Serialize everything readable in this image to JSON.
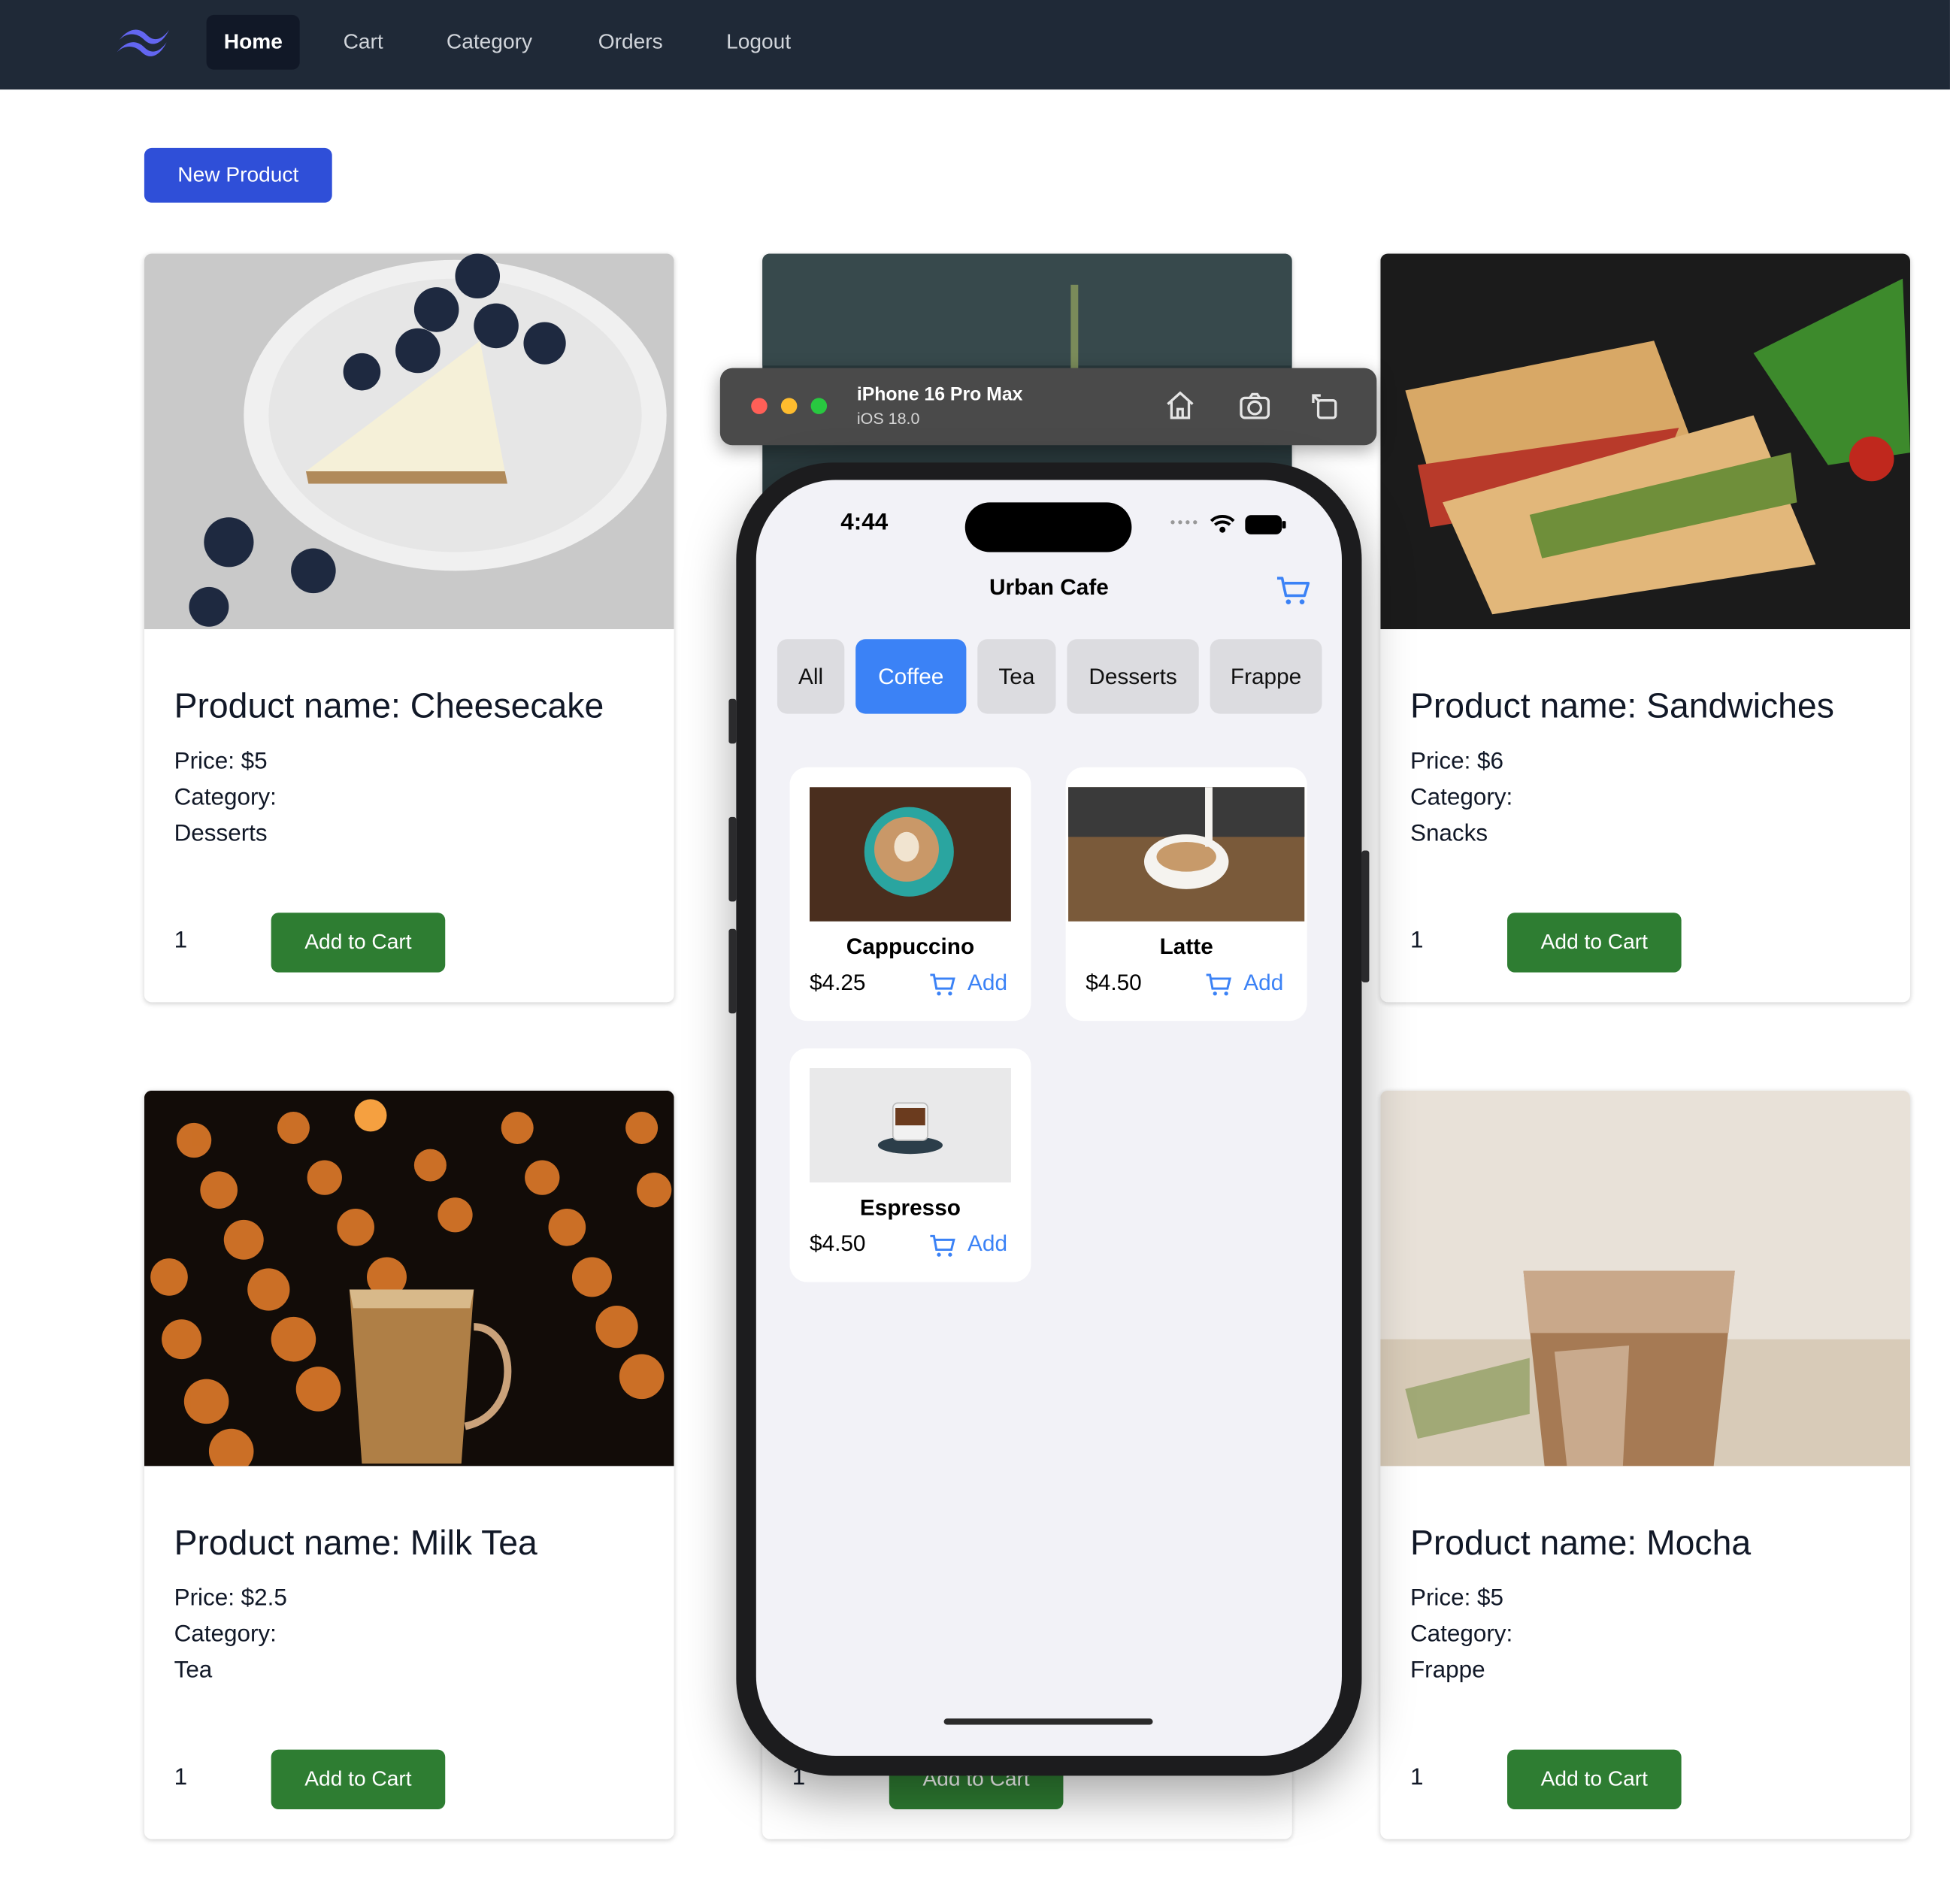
{
  "nav": {
    "items": [
      {
        "label": "Home",
        "active": true
      },
      {
        "label": "Cart"
      },
      {
        "label": "Category"
      },
      {
        "label": "Orders"
      },
      {
        "label": "Logout"
      }
    ]
  },
  "new_product_label": "New Product",
  "products": [
    {
      "name": "Product name: Cheesecake",
      "price": "Price: $5",
      "category_label": "Category:",
      "category": "Desserts",
      "qty": "1",
      "button": "Add to Cart"
    },
    {
      "name": "",
      "price": "",
      "category_label": "",
      "category": "",
      "qty": "1",
      "button": "Add to Cart"
    },
    {
      "name": "Product name: Sandwiches",
      "price": "Price: $6",
      "category_label": "Category:",
      "category": "Snacks",
      "qty": "1",
      "button": "Add to Cart"
    },
    {
      "name": "Product name: Milk Tea",
      "price": "Price: $2.5",
      "category_label": "Category:",
      "category": "Tea",
      "qty": "1",
      "button": "Add to Cart"
    },
    {
      "name": "Product name: Mocha",
      "price": "Price: $5",
      "category_label": "Category:",
      "category": "Frappe",
      "qty": "1",
      "button": "Add to Cart"
    }
  ],
  "simulator": {
    "device": "iPhone 16 Pro Max",
    "os": "iOS 18.0",
    "icons": [
      "home-icon",
      "screenshot-icon",
      "rotate-icon"
    ]
  },
  "app": {
    "status_time": "4:44",
    "title": "Urban Cafe",
    "tabs": [
      {
        "label": "All"
      },
      {
        "label": "Coffee",
        "active": true
      },
      {
        "label": "Tea"
      },
      {
        "label": "Desserts"
      },
      {
        "label": "Frappe"
      }
    ],
    "items": [
      {
        "name": "Cappuccino",
        "price": "$4.25",
        "add": "Add"
      },
      {
        "name": "Latte",
        "price": "$4.50",
        "add": "Add"
      },
      {
        "name": "Espresso",
        "price": "$4.50",
        "add": "Add"
      }
    ]
  },
  "colors": {
    "nav_bg": "#1f2937",
    "primary_blue": "#2f4fd8",
    "cart_green": "#2e7d32",
    "ios_blue": "#3b82f6"
  }
}
